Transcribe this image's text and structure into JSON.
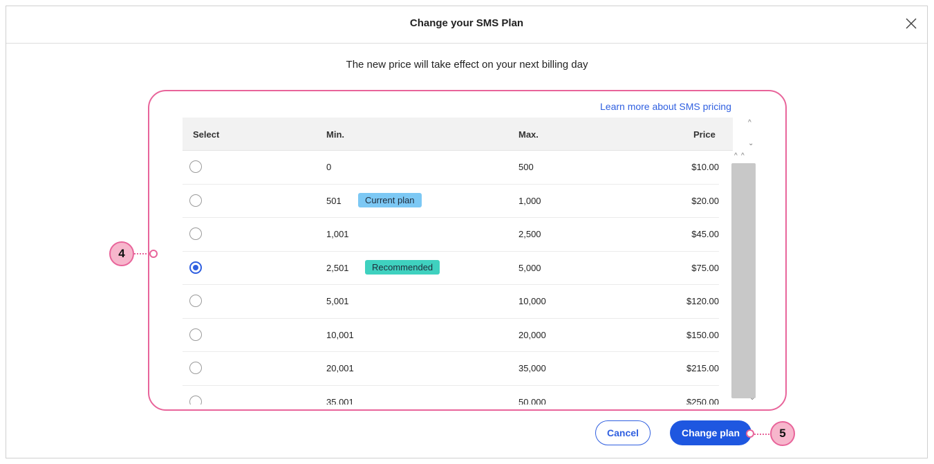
{
  "modal": {
    "title": "Change your SMS Plan",
    "subtitle": "The new price will take effect on your next billing day",
    "learn_more": "Learn more about SMS pricing"
  },
  "table": {
    "headers": {
      "select": "Select",
      "min": "Min.",
      "max": "Max.",
      "price": "Price"
    },
    "rows": [
      {
        "min": "0",
        "max": "500",
        "price": "$10.00",
        "selected": false,
        "badge": ""
      },
      {
        "min": "501",
        "max": "1,000",
        "price": "$20.00",
        "selected": false,
        "badge": "Current plan"
      },
      {
        "min": "1,001",
        "max": "2,500",
        "price": "$45.00",
        "selected": false,
        "badge": ""
      },
      {
        "min": "2,501",
        "max": "5,000",
        "price": "$75.00",
        "selected": true,
        "badge": "Recommended"
      },
      {
        "min": "5,001",
        "max": "10,000",
        "price": "$120.00",
        "selected": false,
        "badge": ""
      },
      {
        "min": "10,001",
        "max": "20,000",
        "price": "$150.00",
        "selected": false,
        "badge": ""
      },
      {
        "min": "20,001",
        "max": "35,000",
        "price": "$215.00",
        "selected": false,
        "badge": ""
      },
      {
        "min": "35,001",
        "max": "50,000",
        "price": "$250.00",
        "selected": false,
        "badge": ""
      }
    ]
  },
  "buttons": {
    "cancel": "Cancel",
    "change_plan": "Change plan"
  },
  "annotations": {
    "table_step": "4",
    "button_step": "5"
  },
  "colors": {
    "accent": "#2f5fe0",
    "highlight": "#e8649a",
    "current_badge": "#7cc8f4",
    "recommended_badge": "#3fd1bf"
  }
}
